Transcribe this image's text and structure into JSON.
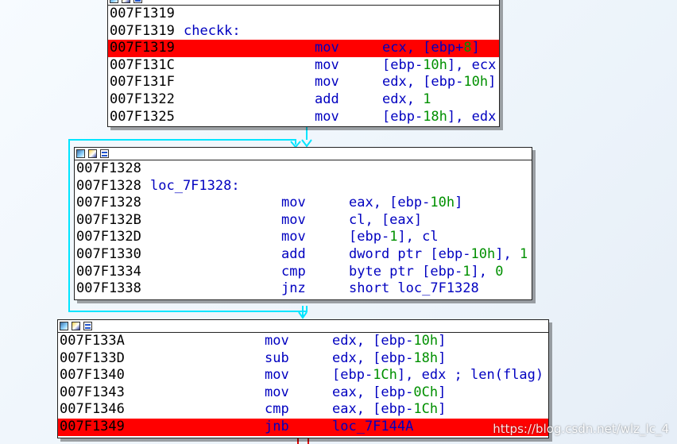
{
  "colors": {
    "address": "#000000",
    "code": "#0000c0",
    "number": "#009000",
    "highlight": "#ff0000",
    "edge": "#00e5ff"
  },
  "header_icons": [
    "color-palette-icon",
    "edit-node-icon",
    "graph-view-icon"
  ],
  "block1": {
    "rows": [
      {
        "addr": "007F1319",
        "label": ""
      },
      {
        "addr": "007F1319",
        "label": "checkk:"
      },
      {
        "addr": "007F1319",
        "mnemonic": "mov",
        "op": [
          "ecx, [ebp+",
          {
            "n": "8"
          },
          "]"
        ],
        "highlight": true
      },
      {
        "addr": "007F131C",
        "mnemonic": "mov",
        "op": [
          "[ebp-",
          {
            "n": "10h"
          },
          "], ecx"
        ]
      },
      {
        "addr": "007F131F",
        "mnemonic": "mov",
        "op": [
          "edx, [ebp-",
          {
            "n": "10h"
          },
          "]"
        ]
      },
      {
        "addr": "007F1322",
        "mnemonic": "add",
        "op": [
          "edx, ",
          {
            "n": "1"
          }
        ]
      },
      {
        "addr": "007F1325",
        "mnemonic": "mov",
        "op": [
          "[ebp-",
          {
            "n": "18h"
          },
          "], edx"
        ]
      }
    ]
  },
  "block2": {
    "rows": [
      {
        "addr": "007F1328",
        "label": ""
      },
      {
        "addr": "007F1328",
        "label": "loc_7F1328:"
      },
      {
        "addr": "007F1328",
        "mnemonic": "mov",
        "op": [
          "eax, [ebp-",
          {
            "n": "10h"
          },
          "]"
        ]
      },
      {
        "addr": "007F132B",
        "mnemonic": "mov",
        "op": [
          "cl, [eax]"
        ]
      },
      {
        "addr": "007F132D",
        "mnemonic": "mov",
        "op": [
          "[ebp-",
          {
            "n": "1"
          },
          "], cl"
        ]
      },
      {
        "addr": "007F1330",
        "mnemonic": "add",
        "op": [
          "dword ptr [ebp-",
          {
            "n": "10h"
          },
          "], ",
          {
            "n": "1"
          }
        ]
      },
      {
        "addr": "007F1334",
        "mnemonic": "cmp",
        "op": [
          "byte ptr [ebp-",
          {
            "n": "1"
          },
          "], ",
          {
            "n": "0"
          }
        ]
      },
      {
        "addr": "007F1338",
        "mnemonic": "jnz",
        "op": [
          "short loc_7F1328"
        ]
      }
    ]
  },
  "block3": {
    "rows": [
      {
        "addr": "007F133A",
        "mnemonic": "mov",
        "op": [
          "edx, [ebp-",
          {
            "n": "10h"
          },
          "]"
        ]
      },
      {
        "addr": "007F133D",
        "mnemonic": "sub",
        "op": [
          "edx, [ebp-",
          {
            "n": "18h"
          },
          "]"
        ]
      },
      {
        "addr": "007F1340",
        "mnemonic": "mov",
        "op": [
          "[ebp-",
          {
            "n": "1Ch"
          },
          "], edx ; len(flag)"
        ]
      },
      {
        "addr": "007F1343",
        "mnemonic": "mov",
        "op": [
          "eax, [ebp-",
          {
            "n": "0Ch"
          },
          "]"
        ]
      },
      {
        "addr": "007F1346",
        "mnemonic": "cmp",
        "op": [
          "eax, [ebp-",
          {
            "n": "1Ch"
          },
          "]"
        ]
      },
      {
        "addr": "007F1349",
        "mnemonic": "jnb",
        "op": [
          "loc_7F144A"
        ],
        "highlight": true
      }
    ]
  },
  "watermark": "https://blog.csdn.net/wlz_lc_4"
}
